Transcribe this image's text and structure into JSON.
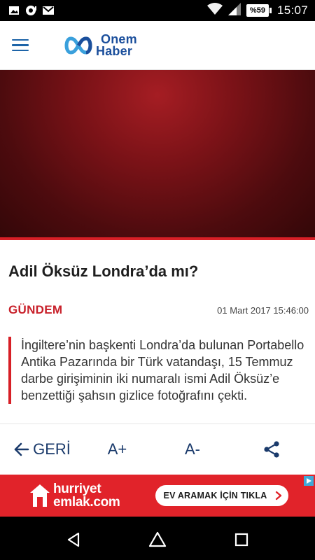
{
  "status_bar": {
    "battery": "%59",
    "time": "15:07",
    "icons": [
      "image-icon",
      "camera-record-icon",
      "gmail-icon",
      "wifi-icon",
      "signal-icon",
      "battery-icon"
    ]
  },
  "app_bar": {
    "menu_icon": "hamburger-menu-icon",
    "logo_line1": "Onem",
    "logo_line2": "Haber"
  },
  "article": {
    "title": "Adil Öksüz Londra’da mı?",
    "category": "GÜNDEM",
    "date": "01 Mart 2017 15:46:00",
    "summary": "İngiltere’nin başkenti Londra’da bulunan Portabello Antika Pazarında bir Türk vatandaşı, 15 Temmuz darbe girişiminin iki numaralı ismi Adil Öksüz’e benzettiği şahsın gizlice fotoğrafını çekti."
  },
  "actions": {
    "back_label": "GERİ",
    "font_increase": "A+",
    "font_decrease": "A-",
    "share_icon": "share-icon"
  },
  "ad": {
    "brand_line1": "hurriyet",
    "brand_line2": "emlak.com",
    "cta": "EV ARAMAK İÇİN TIKLA"
  },
  "colors": {
    "accent": "#d71f26",
    "brand_blue": "#1b4f9c",
    "ad_red": "#e1232a"
  }
}
